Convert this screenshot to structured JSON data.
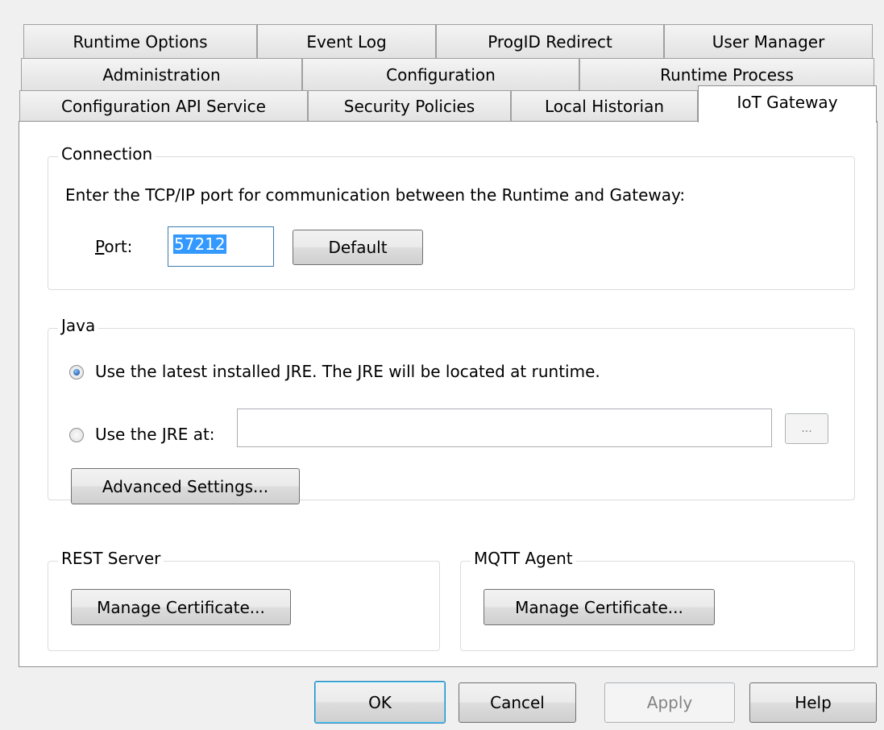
{
  "tabs": {
    "row1": [
      "Runtime Options",
      "Event Log",
      "ProgID Redirect",
      "User Manager"
    ],
    "row2": [
      "Administration",
      "Configuration",
      "Runtime Process"
    ],
    "row3": [
      "Configuration API Service",
      "Security Policies",
      "Local Historian",
      "IoT Gateway"
    ],
    "active": "IoT Gateway"
  },
  "connection": {
    "title": "Connection",
    "instruction": "Enter the TCP/IP port for communication between the Runtime and Gateway:",
    "port_label": "Port:",
    "port_value": "57212",
    "default_button": "Default"
  },
  "java": {
    "title": "Java",
    "option_latest": "Use the latest installed JRE. The JRE will be located at runtime.",
    "option_latest_selected": true,
    "option_path": "Use the JRE at:",
    "jre_path_value": "",
    "browse_button": "...",
    "advanced_button": "Advanced Settings..."
  },
  "rest_server": {
    "title": "REST Server",
    "manage_button": "Manage Certificate..."
  },
  "mqtt_agent": {
    "title": "MQTT Agent",
    "manage_button": "Manage Certificate..."
  },
  "footer": {
    "ok": "OK",
    "cancel": "Cancel",
    "apply": "Apply",
    "help": "Help"
  }
}
